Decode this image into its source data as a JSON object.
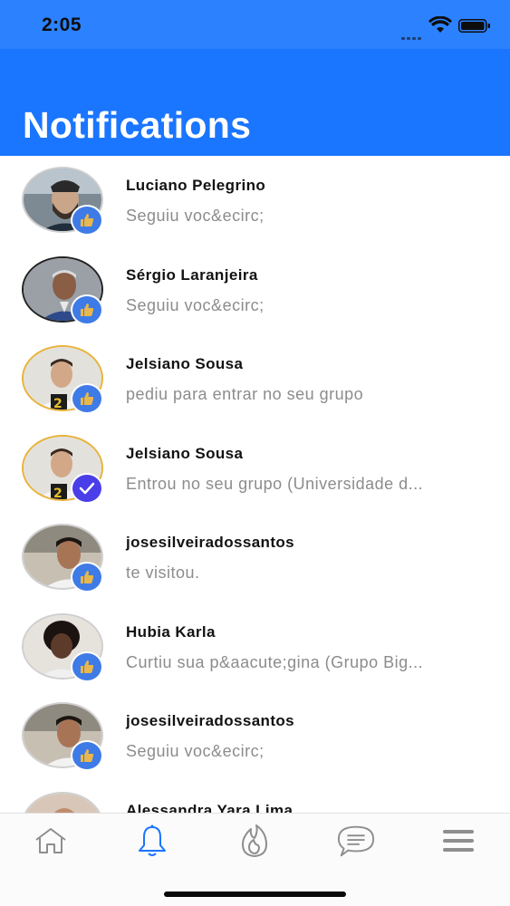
{
  "status_bar": {
    "time": "2:05"
  },
  "header": {
    "title": "Notifications"
  },
  "notifications": [
    {
      "name": "Luciano Pelegrino",
      "text": "Seguiu voc&ecirc;",
      "badge": "thumbs-up-icon"
    },
    {
      "name": "Sérgio Laranjeira",
      "text": "Seguiu voc&ecirc;",
      "badge": "thumbs-up-icon"
    },
    {
      "name": "Jelsiano Sousa",
      "text": "pediu para entrar no seu grupo",
      "badge": "thumbs-up-icon"
    },
    {
      "name": "Jelsiano Sousa",
      "text": "Entrou no seu grupo (Universidade d...",
      "badge": "check-icon"
    },
    {
      "name": "josesilveiradossantos",
      "text": "te visitou.",
      "badge": "thumbs-up-icon"
    },
    {
      "name": "Hubia Karla",
      "text": "Curtiu sua p&aacute;gina (Grupo Big...",
      "badge": "thumbs-up-icon"
    },
    {
      "name": "josesilveiradossantos",
      "text": "Seguiu voc&ecirc;",
      "badge": "thumbs-up-icon"
    },
    {
      "name": "Alessandra Yara Lima",
      "text": "",
      "badge": ""
    }
  ],
  "tabbar": {
    "tabs": [
      {
        "icon": "home-icon",
        "active": false
      },
      {
        "icon": "bell-icon",
        "active": true
      },
      {
        "icon": "flame-icon",
        "active": false
      },
      {
        "icon": "chat-bubble-icon",
        "active": false
      },
      {
        "icon": "menu-icon",
        "active": false
      }
    ]
  },
  "colors": {
    "accent": "#1a75ff",
    "inactive_icon": "#8e8e8e",
    "badge": "#3f7be6",
    "badge_check": "#4a3ee8"
  }
}
